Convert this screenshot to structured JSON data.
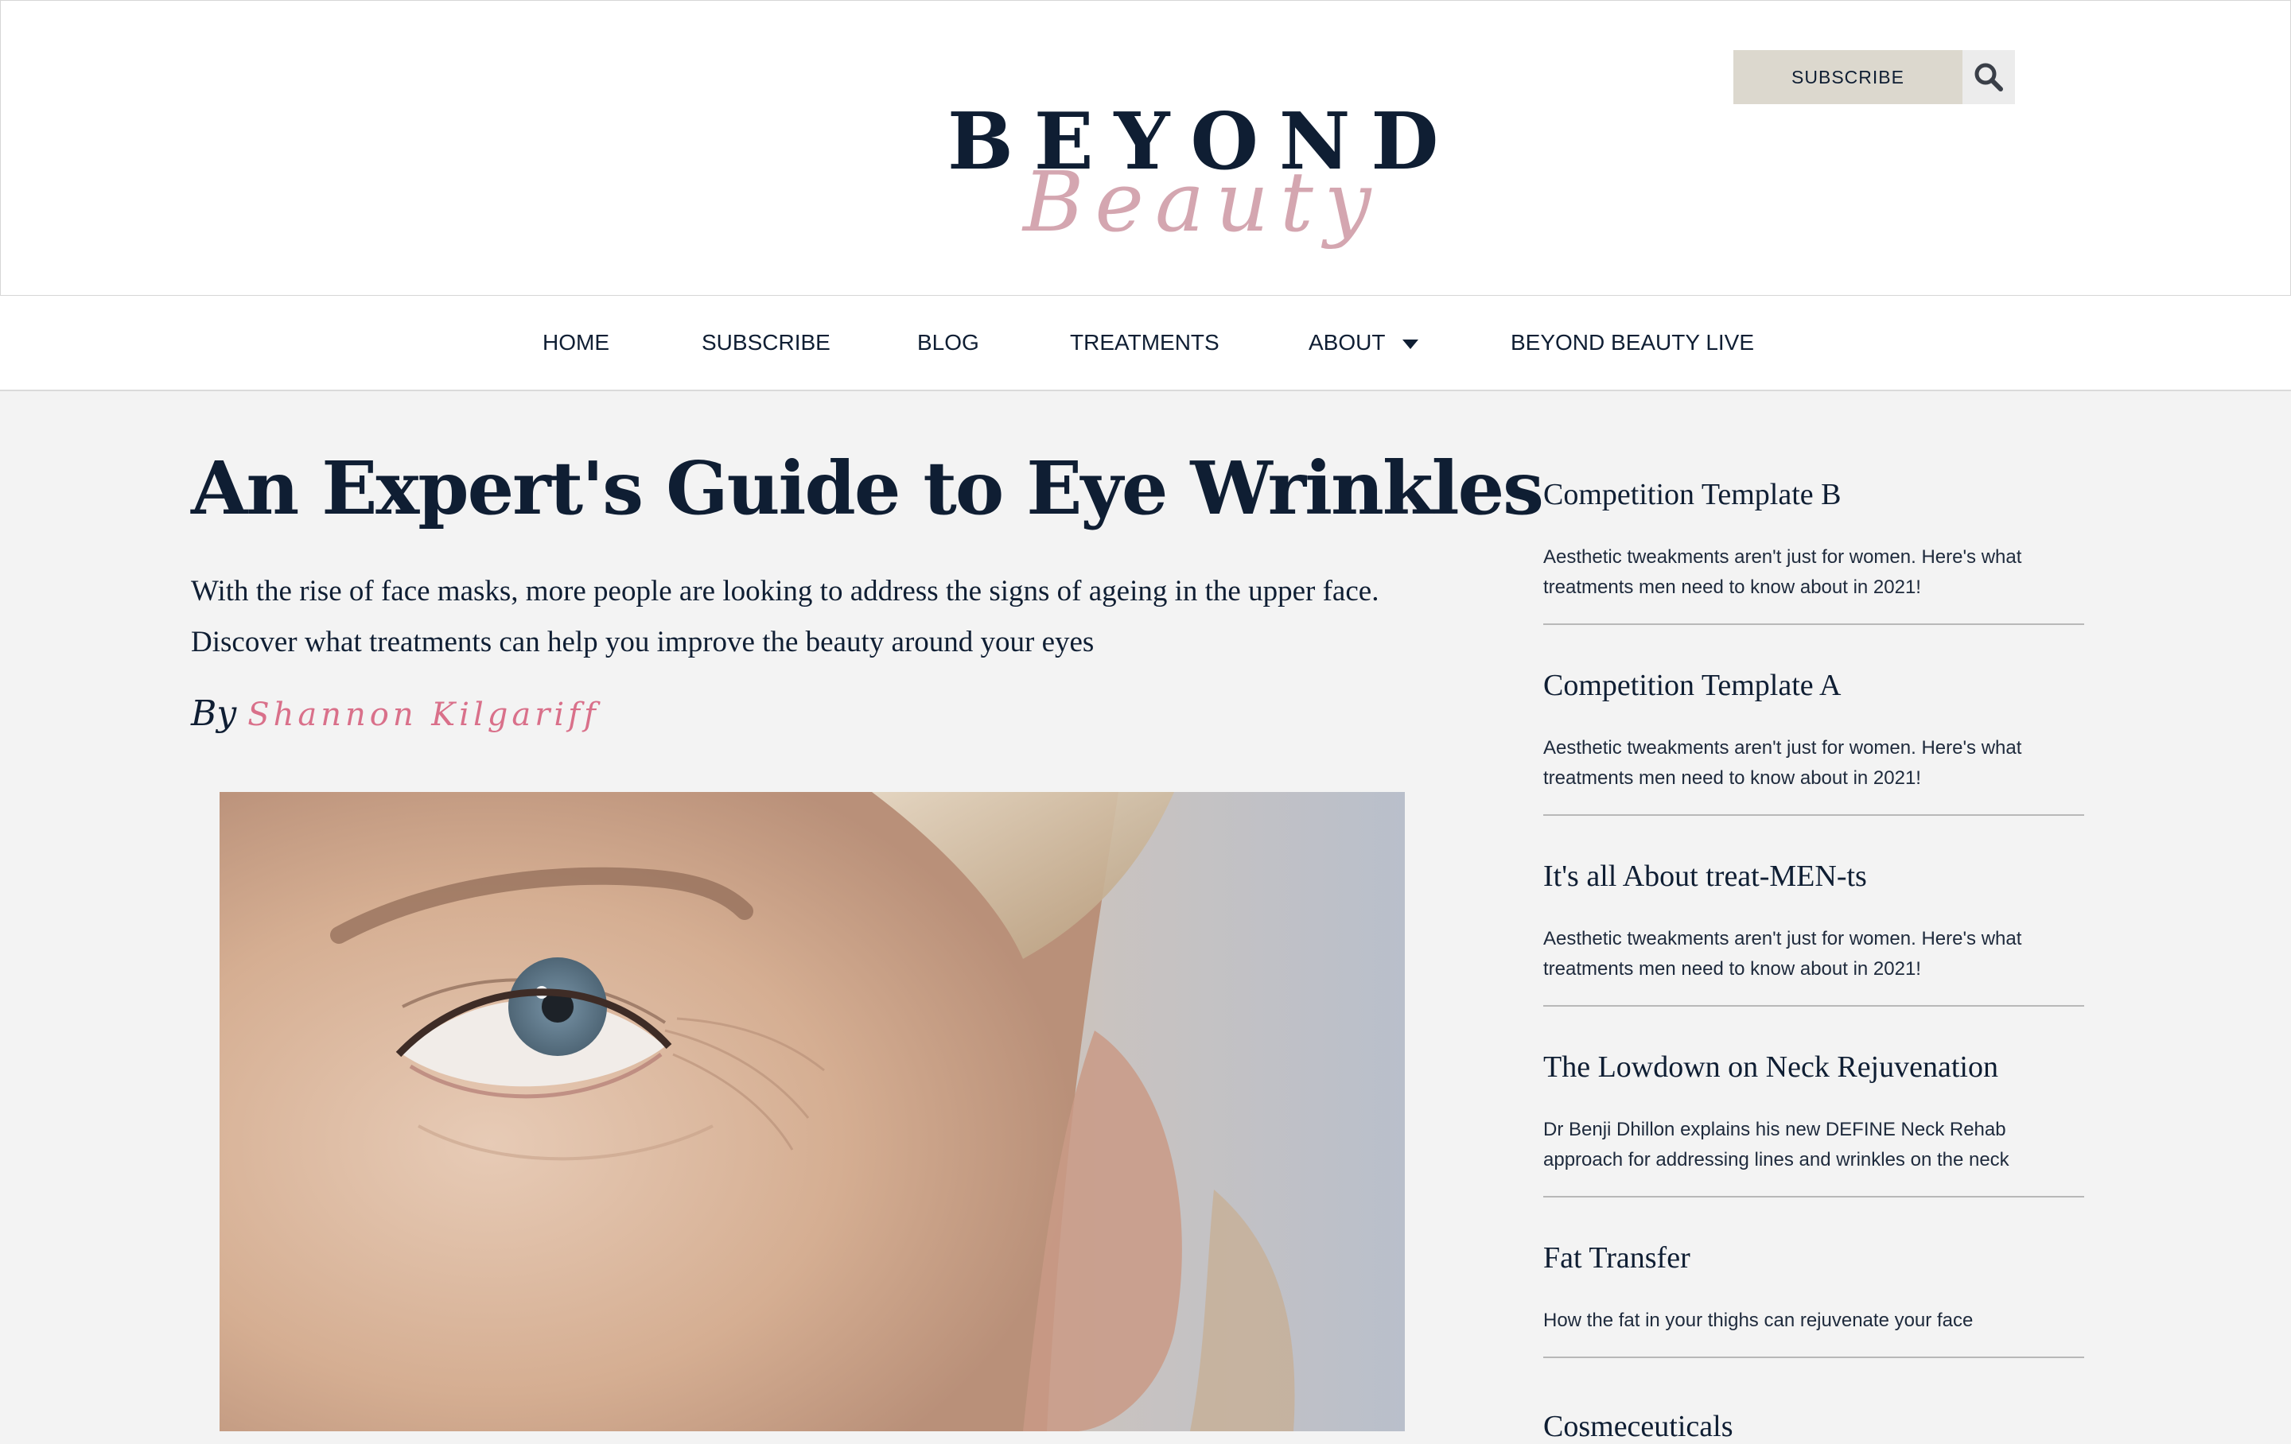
{
  "header": {
    "logo_main": "BEYOND",
    "logo_script": "Beauty",
    "subscribe_label": "SUBSCRIBE",
    "search_icon": "search-icon"
  },
  "nav": {
    "items": [
      "HOME",
      "SUBSCRIBE",
      "BLOG",
      "TREATMENTS",
      "ABOUT",
      "BEYOND BEAUTY LIVE"
    ],
    "about_dropdown_icon": "caret-down-icon"
  },
  "article": {
    "title": "An Expert's Guide to Eye Wrinkles",
    "subtitle": "With the rise of face masks, more people are looking to address the signs of ageing in the upper face. Discover what treatments can help you improve the beauty around your eyes",
    "by_label": "By",
    "author": "Shannon Kilgariff"
  },
  "sidebar": {
    "items": [
      {
        "title": "Competition Template B",
        "desc": "Aesthetic tweakments aren't just for women. Here's what treatments men need to know about in 2021!"
      },
      {
        "title": "Competition Template A",
        "desc": "Aesthetic tweakments aren't just for women. Here's what treatments men need to know about in 2021!"
      },
      {
        "title": "It's all About treat-MEN-ts",
        "desc": "Aesthetic tweakments aren't just for women. Here's what treatments men need to know about in 2021!"
      },
      {
        "title": "The Lowdown on Neck Rejuvenation",
        "desc": "Dr Benji Dhillon explains his new DEFINE Neck Rehab approach for addressing lines and wrinkles on the neck"
      },
      {
        "title": "Fat Transfer",
        "desc": "How the fat in your thighs can rejuvenate your face"
      },
      {
        "title": "Cosmeceuticals",
        "desc": ""
      }
    ]
  },
  "colors": {
    "navy": "#0f1e33",
    "accent_pink": "#d9708a",
    "logo_pink": "#d4a6b0",
    "subscribe_bg": "#dcd8ce",
    "page_bg": "#f3f3f3"
  }
}
